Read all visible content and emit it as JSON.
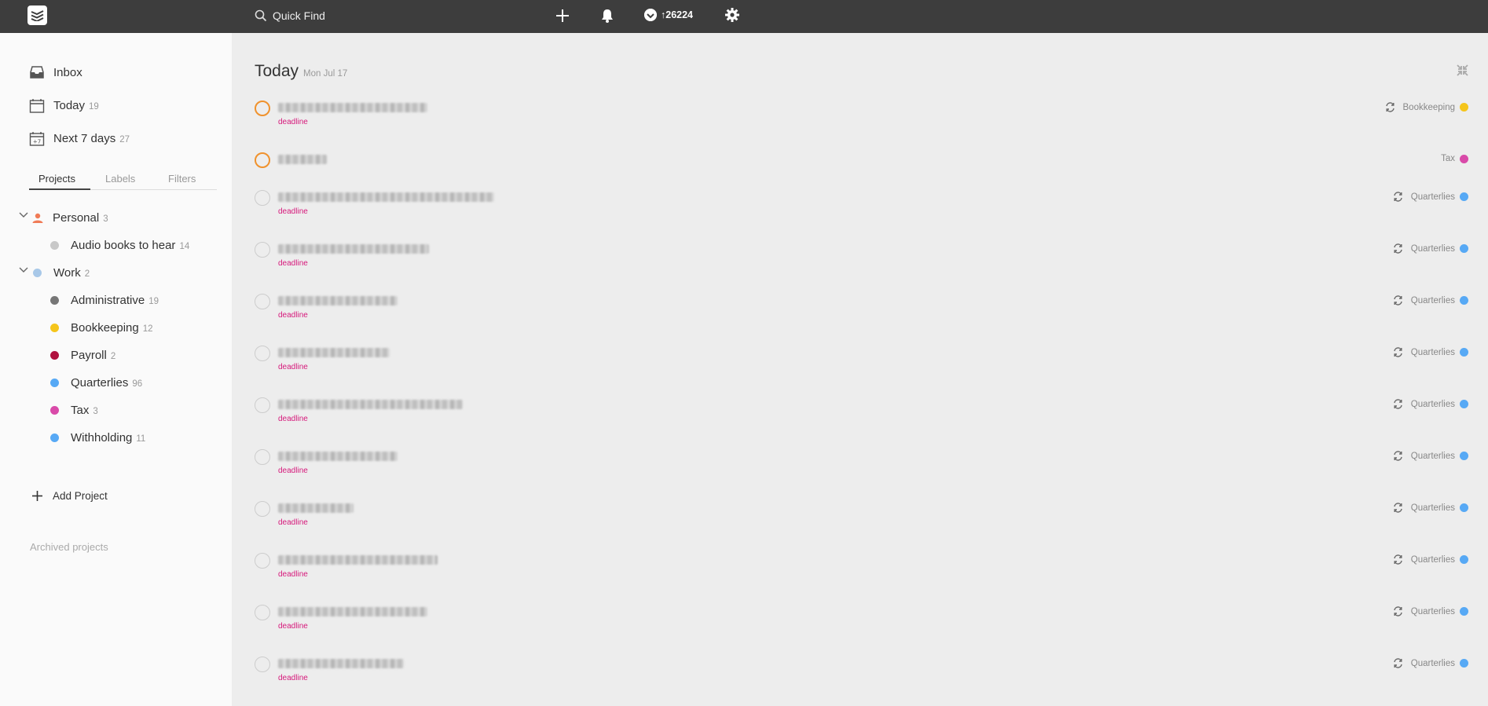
{
  "topbar": {
    "quick_find": "Quick Find",
    "karma": "↑26224"
  },
  "sidebar": {
    "nav": [
      {
        "label": "Inbox",
        "count": ""
      },
      {
        "label": "Today",
        "count": "19"
      },
      {
        "label": "Next 7 days",
        "count": "27"
      }
    ],
    "next7_icon_text": "+7",
    "tabs": [
      "Projects",
      "Labels",
      "Filters"
    ],
    "projects": [
      {
        "label": "Personal",
        "count": "3",
        "color": "#f07b56",
        "icon": "person-icon"
      },
      {
        "label": "Audio books to hear",
        "count": "14",
        "color": "#c8c8c8"
      },
      {
        "label": "Work",
        "count": "2",
        "color": "#a8c8e8"
      },
      {
        "label": "Administrative",
        "count": "19",
        "color": "#767676"
      },
      {
        "label": "Bookkeeping",
        "count": "12",
        "color": "#f5c51b"
      },
      {
        "label": "Payroll",
        "count": "2",
        "color": "#b0123f"
      },
      {
        "label": "Quarterlies",
        "count": "96",
        "color": "#57a9f5"
      },
      {
        "label": "Tax",
        "count": "3",
        "color": "#d94aa9"
      },
      {
        "label": "Withholding",
        "count": "11",
        "color": "#57a9f5"
      }
    ],
    "add_project": "Add Project",
    "archived": "Archived projects"
  },
  "main": {
    "title": "Today",
    "date": "Mon Jul 17",
    "tasks": [
      {
        "label": "deadline",
        "project": "Bookkeeping",
        "color": "#f5c51b",
        "priority": "p1",
        "recurring": true
      },
      {
        "label": "",
        "project": "Tax",
        "color": "#d94aa9",
        "priority": "p1",
        "recurring": false
      },
      {
        "label": "deadline",
        "project": "Quarterlies",
        "color": "#57a9f5",
        "priority": "p4",
        "recurring": true
      },
      {
        "label": "deadline",
        "project": "Quarterlies",
        "color": "#57a9f5",
        "priority": "p4",
        "recurring": true
      },
      {
        "label": "deadline",
        "project": "Quarterlies",
        "color": "#57a9f5",
        "priority": "p4",
        "recurring": true
      },
      {
        "label": "deadline",
        "project": "Quarterlies",
        "color": "#57a9f5",
        "priority": "p4",
        "recurring": true
      },
      {
        "label": "deadline",
        "project": "Quarterlies",
        "color": "#57a9f5",
        "priority": "p4",
        "recurring": true
      },
      {
        "label": "deadline",
        "project": "Quarterlies",
        "color": "#57a9f5",
        "priority": "p4",
        "recurring": true
      },
      {
        "label": "deadline",
        "project": "Quarterlies",
        "color": "#57a9f5",
        "priority": "p4",
        "recurring": true
      },
      {
        "label": "deadline",
        "project": "Quarterlies",
        "color": "#57a9f5",
        "priority": "p4",
        "recurring": true
      },
      {
        "label": "deadline",
        "project": "Quarterlies",
        "color": "#57a9f5",
        "priority": "p4",
        "recurring": true
      },
      {
        "label": "deadline",
        "project": "Quarterlies",
        "color": "#57a9f5",
        "priority": "p4",
        "recurring": true
      }
    ]
  }
}
